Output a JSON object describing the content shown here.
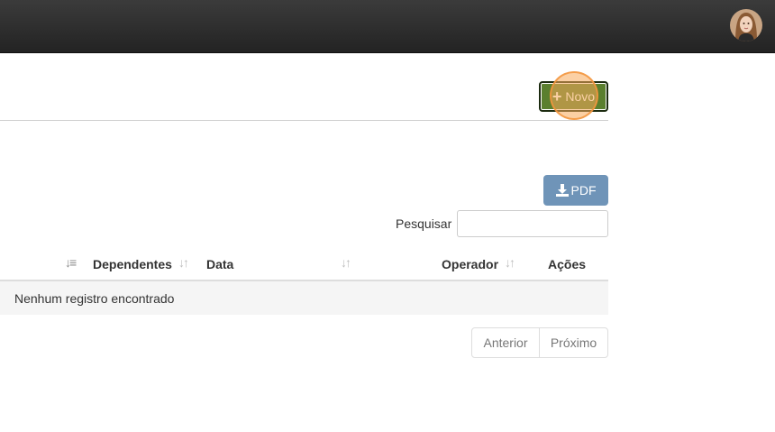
{
  "header": {
    "avatar_icon": "user-avatar-photo"
  },
  "toolbar": {
    "new_label": "Novo",
    "new_icon": "plus-icon",
    "new_color": "#5a7f2e"
  },
  "export": {
    "pdf_label": "PDF",
    "pdf_icon": "download-icon",
    "pdf_color": "#6f94b8"
  },
  "search": {
    "label": "Pesquisar",
    "value": "",
    "placeholder": ""
  },
  "table": {
    "columns": [
      {
        "label": "",
        "sort": "active"
      },
      {
        "label": "Dependentes",
        "sort": "both"
      },
      {
        "label": "Data",
        "sort": "both"
      },
      {
        "label": "Operador",
        "sort": "both"
      },
      {
        "label": "Ações",
        "sort": "none"
      }
    ],
    "empty_message": "Nenhum registro encontrado"
  },
  "pagination": {
    "prev_label": "Anterior",
    "next_label": "Próximo"
  }
}
